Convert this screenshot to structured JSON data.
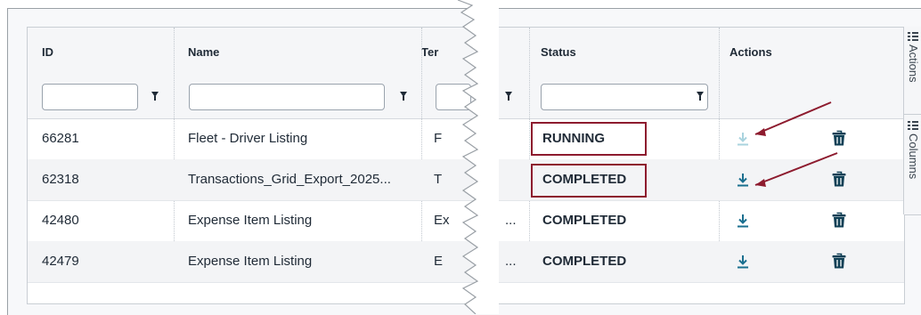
{
  "headers": {
    "id": "ID",
    "name": "Name",
    "template": "Ter",
    "status": "Status",
    "actions": "Actions"
  },
  "filters": {
    "id": "",
    "name": "",
    "template": "",
    "status": ""
  },
  "rows": [
    {
      "id": "66281",
      "name": "Fleet - Driver Listing",
      "template": "F",
      "extra": "",
      "status": "RUNNING",
      "download_enabled": false
    },
    {
      "id": "62318",
      "name": "Transactions_Grid_Export_2025...",
      "template": "T",
      "extra": "",
      "status": "COMPLETED",
      "download_enabled": true
    },
    {
      "id": "42480",
      "name": "Expense Item Listing",
      "template": "Ex",
      "extra": "...",
      "status": "COMPLETED",
      "download_enabled": true
    },
    {
      "id": "42479",
      "name": "Expense Item Listing",
      "template": "E",
      "extra": "...",
      "status": "COMPLETED",
      "download_enabled": true
    }
  ],
  "side_panel": {
    "actions": "Actions",
    "columns": "Columns"
  },
  "icons": {
    "filter": "filter-icon",
    "download": "download-icon",
    "delete": "trash-icon",
    "side_tab": "grid-icon"
  },
  "colors": {
    "highlight": "#8d1b2e",
    "download": "#1a6f8f",
    "download_disabled": "#a9d3de",
    "trash": "#0f3f55"
  }
}
